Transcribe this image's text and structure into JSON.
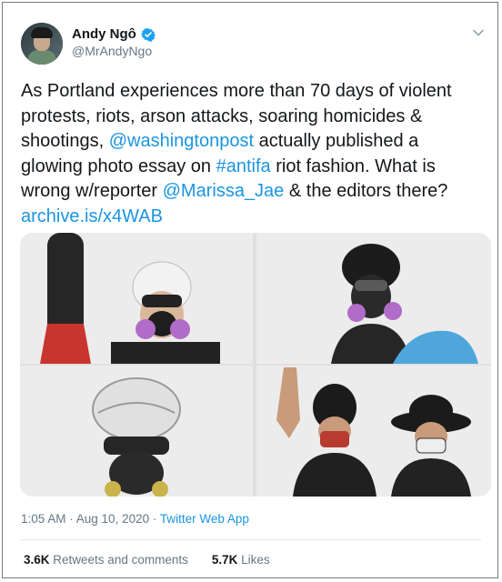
{
  "author": {
    "name": "Andy Ngô",
    "handle": "@MrAndyNgo"
  },
  "tweet": {
    "text_1": "As Portland experiences more than 70 days of violent protests, riots, arson attacks, soaring homicides & shootings, ",
    "mention_1": "@washingtonpost",
    "text_2": " actually published a glowing photo essay on ",
    "hashtag": "#antifa",
    "text_3": " riot fashion. What is wrong w/reporter ",
    "mention_2": "@Marissa_Jae",
    "text_4": " & the editors there? ",
    "link": "archive.is/x4WAB"
  },
  "meta": {
    "timestamp": "1:05 AM · Aug 10, 2020 · ",
    "app": "Twitter Web App"
  },
  "stats": {
    "retweets_count": "3.6K",
    "retweets_label": " Retweets and comments",
    "likes_count": "5.7K",
    "likes_label": " Likes"
  },
  "colors": {
    "link": "#1b95e0",
    "text": "#14171a",
    "secondary": "#657786",
    "verified": "#1da1f2"
  },
  "icons": [
    "verified-badge-icon",
    "chevron-down-icon"
  ]
}
